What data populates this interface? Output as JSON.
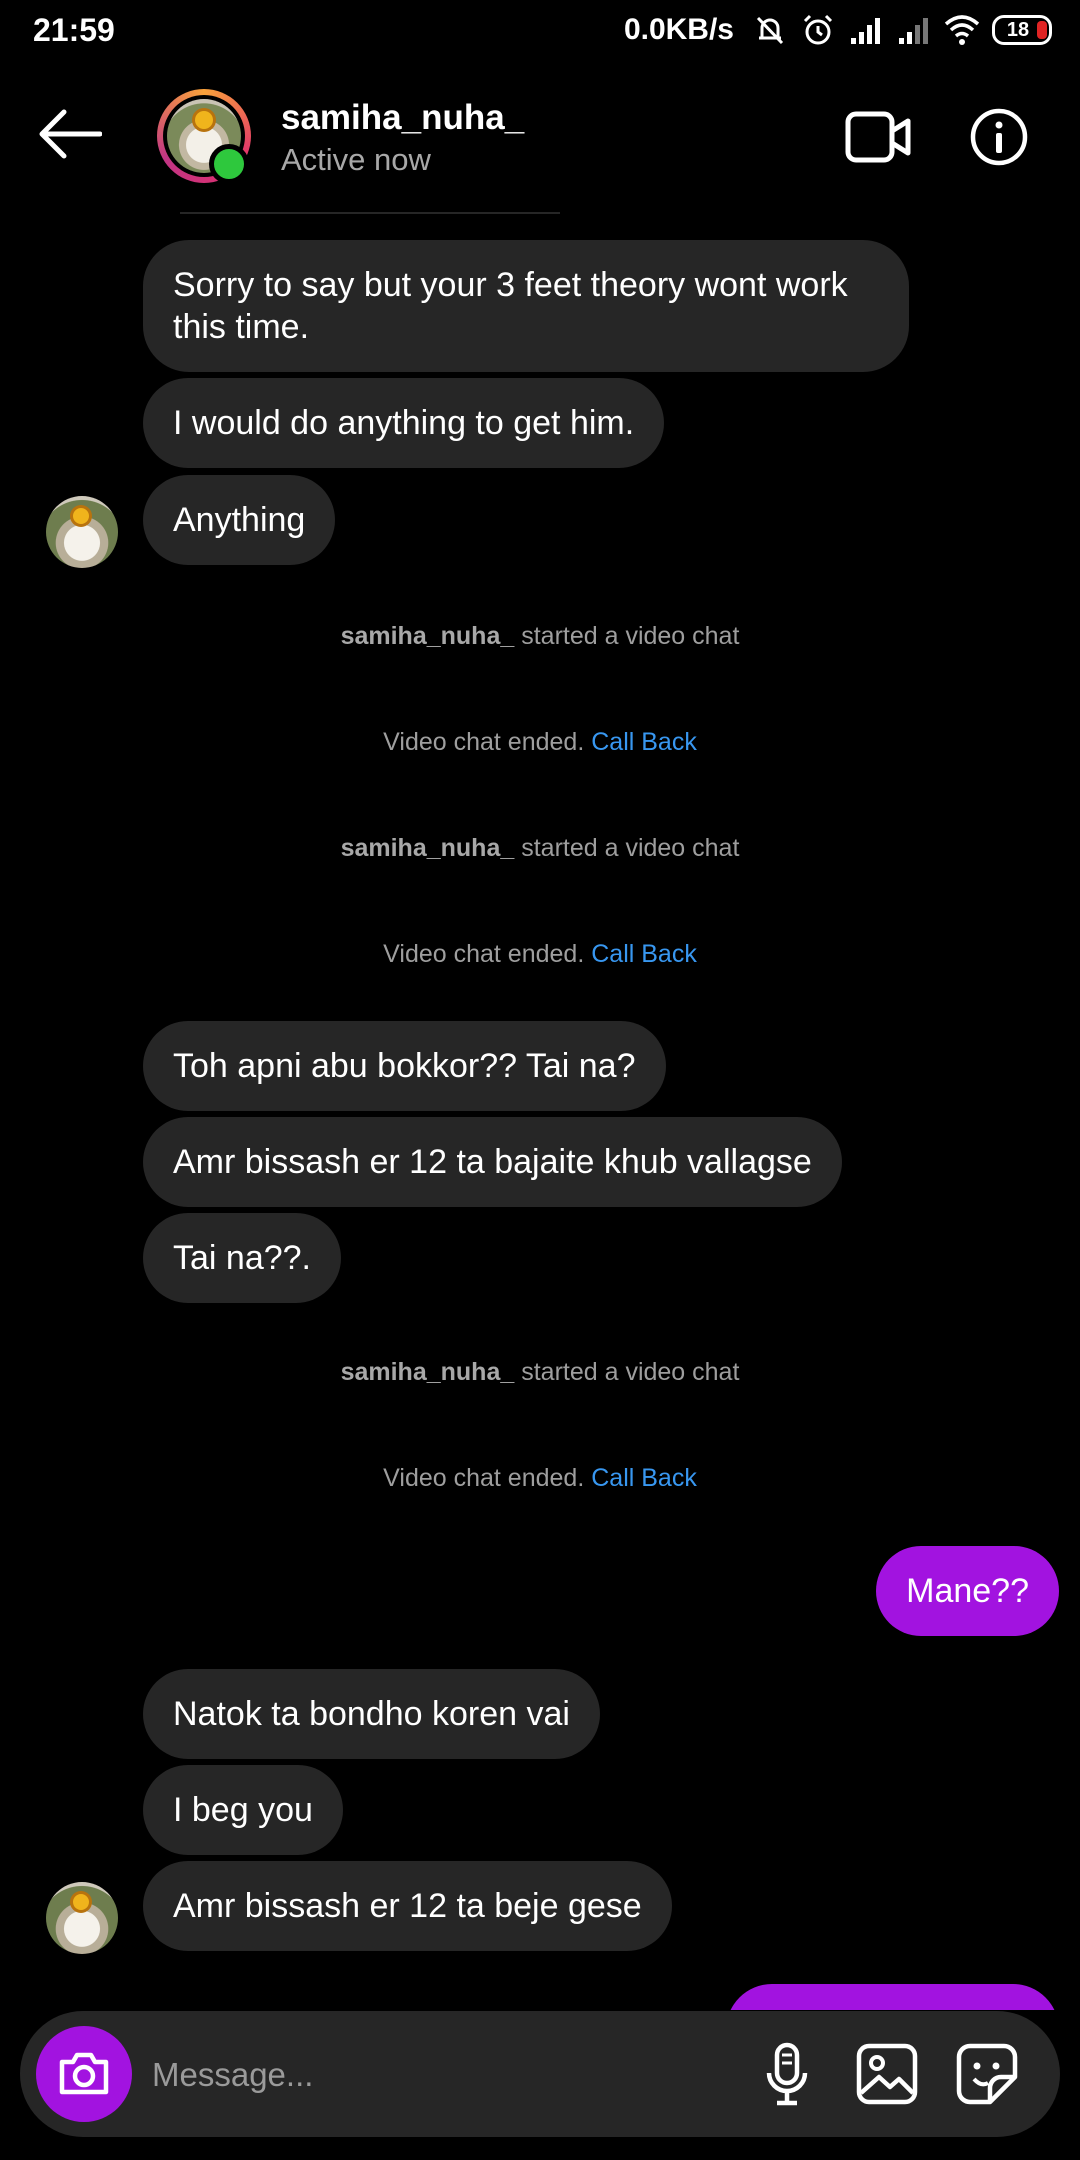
{
  "status_bar": {
    "time": "21:59",
    "net_speed": "0.0KB/s",
    "battery": "18",
    "icons": [
      "mute-icon",
      "alarm-icon",
      "signal-icon",
      "signal-icon",
      "wifi-icon",
      "battery-icon"
    ]
  },
  "header": {
    "username": "samiha_nuha_",
    "status": "Active now",
    "online_color": "#2ec83d"
  },
  "messages": [
    {
      "type": "in",
      "text": "Sorry to say but your 3 feet theory wont work this time."
    },
    {
      "type": "in",
      "text": "I would do anything to get him."
    },
    {
      "type": "in",
      "text": "Anything"
    },
    {
      "type": "system",
      "user": "samiha_nuha_",
      "text": "started a video chat"
    },
    {
      "type": "system",
      "text": "Video chat ended.",
      "link": "Call Back"
    },
    {
      "type": "system",
      "user": "samiha_nuha_",
      "text": "started a video chat"
    },
    {
      "type": "system",
      "text": "Video chat ended.",
      "link": "Call Back"
    },
    {
      "type": "in",
      "text": "Toh apni abu bokkor?? Tai na?"
    },
    {
      "type": "in",
      "text": "Amr bissash er 12 ta bajaite khub vallagse"
    },
    {
      "type": "in",
      "text": "Tai na??."
    },
    {
      "type": "system",
      "user": "samiha_nuha_",
      "text": "started a video chat"
    },
    {
      "type": "system",
      "text": "Video chat ended.",
      "link": "Call Back"
    },
    {
      "type": "out",
      "text": "Mane??"
    },
    {
      "type": "in",
      "text": "Natok ta bondho koren vai"
    },
    {
      "type": "in",
      "text": "I beg you"
    },
    {
      "type": "in",
      "text": "Amr bissash er 12 ta beje gese"
    }
  ],
  "composer": {
    "placeholder": "Message..."
  },
  "colors": {
    "background": "#000000",
    "incoming_bubble": "#262626",
    "outgoing_bubble": "#a213e0",
    "link": "#3897f0"
  }
}
